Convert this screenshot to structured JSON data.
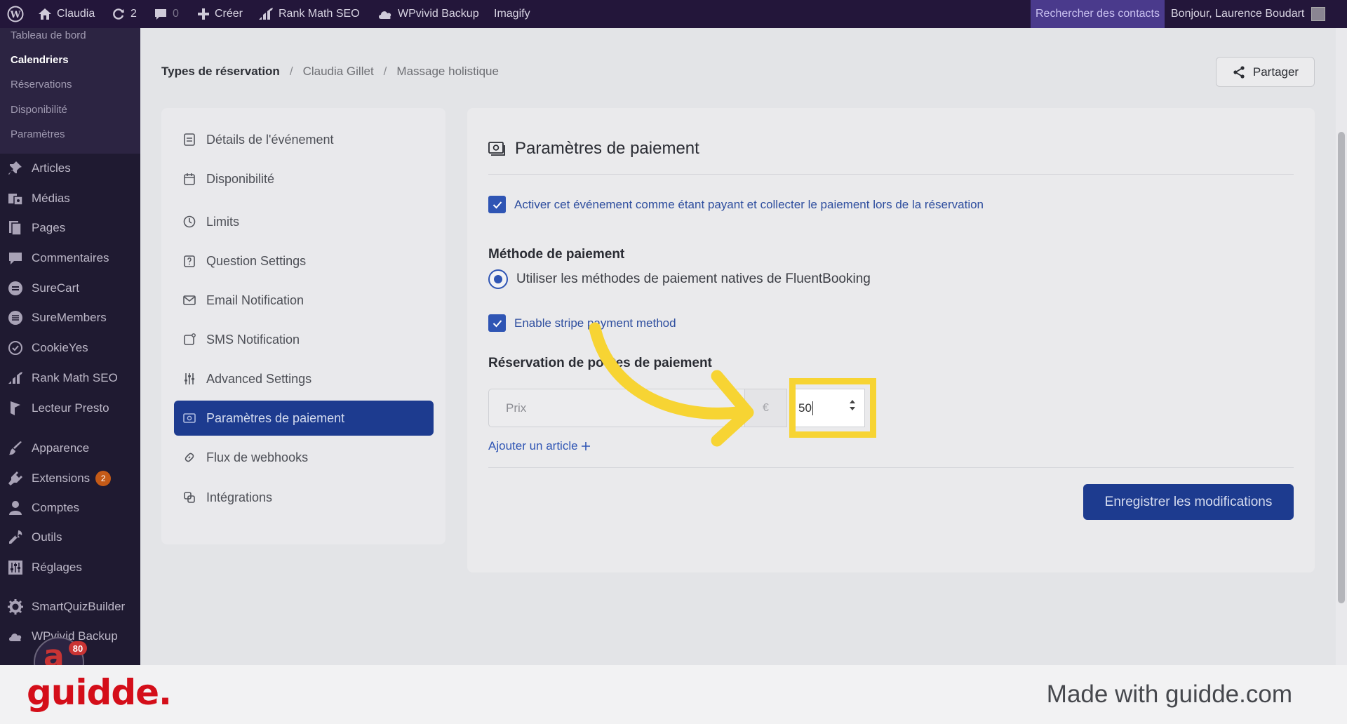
{
  "adminbar": {
    "site_name": "Claudia",
    "updates_count": "2",
    "comments_count": "0",
    "new_label": "Créer",
    "rankmath_label": "Rank Math SEO",
    "wpvivid_label": "WPvivid Backup",
    "imagify_label": "Imagify",
    "search_contacts_label": "Rechercher des contacts",
    "greeting": "Bonjour, Laurence Boudart"
  },
  "sidebar": {
    "submenu": [
      "Tableau de bord",
      "Calendriers",
      "Réservations",
      "Disponibilité",
      "Paramètres"
    ],
    "current_submenu": "Calendriers",
    "items": [
      {
        "label": "Articles",
        "icon": "pin-icon"
      },
      {
        "label": "Médias",
        "icon": "media-icon"
      },
      {
        "label": "Pages",
        "icon": "pages-icon"
      },
      {
        "label": "Commentaires",
        "icon": "comments-icon"
      },
      {
        "label": "SureCart",
        "icon": "surecart-icon"
      },
      {
        "label": "SureMembers",
        "icon": "suremembers-icon"
      },
      {
        "label": "CookieYes",
        "icon": "cookie-icon"
      },
      {
        "label": "Rank Math SEO",
        "icon": "rankmath-icon"
      },
      {
        "label": "Lecteur Presto",
        "icon": "presto-icon"
      },
      {
        "label": "Apparence",
        "icon": "brush-icon"
      },
      {
        "label": "Extensions",
        "icon": "plugin-icon",
        "badge": "2"
      },
      {
        "label": "Comptes",
        "icon": "user-icon"
      },
      {
        "label": "Outils",
        "icon": "wrench-icon"
      },
      {
        "label": "Réglages",
        "icon": "settings-icon"
      },
      {
        "label": "SmartQuizBuilder",
        "icon": "gear-icon"
      },
      {
        "label": "WPvivid Backup",
        "icon": "cloud-icon"
      }
    ],
    "score_badge": {
      "letter": "a",
      "value": "80"
    }
  },
  "breadcrumb": {
    "root": "Types de réservation",
    "sep": "/",
    "items": [
      "Claudia Gillet",
      "Massage holistique"
    ]
  },
  "share_label": "Partager",
  "nav": {
    "items": [
      {
        "label": "Détails de l'événement",
        "icon": "details-icon"
      },
      {
        "label": "Disponibilité",
        "icon": "calendar-icon"
      },
      {
        "label": "Limits",
        "icon": "clock-icon"
      },
      {
        "label": "Question Settings",
        "icon": "question-icon"
      },
      {
        "label": "Email Notification",
        "icon": "mail-icon"
      },
      {
        "label": "SMS Notification",
        "icon": "sms-icon"
      },
      {
        "label": "Advanced Settings",
        "icon": "sliders-icon"
      },
      {
        "label": "Paramètres de paiement",
        "icon": "payment-icon"
      },
      {
        "label": "Flux de webhooks",
        "icon": "link-icon"
      },
      {
        "label": "Intégrations",
        "icon": "integrations-icon"
      }
    ],
    "active_index": 7
  },
  "payment": {
    "title": "Paramètres de paiement",
    "enable_paid_label": "Activer cet événement comme étant payant et collecter le paiement lors de la réservation",
    "enable_paid_checked": true,
    "method_heading": "Méthode de paiement",
    "method_native_label": "Utiliser les méthodes de paiement natives de FluentBooking",
    "stripe_label": "Enable stripe payment method",
    "stripe_checked": true,
    "booking_heading": "Réservation de postes de paiement",
    "price_name_placeholder": "Prix",
    "currency_symbol": "€",
    "amount_value": "50",
    "add_item_label": "Ajouter un article",
    "save_label": "Enregistrer les modifications"
  },
  "footer": {
    "brand": "guidde.",
    "made_with": "Made with guidde.com"
  },
  "colors": {
    "accent": "#1d3b8f",
    "highlight": "#f7d433",
    "admin_bar": "#23163a",
    "brand": "#d40e19"
  }
}
